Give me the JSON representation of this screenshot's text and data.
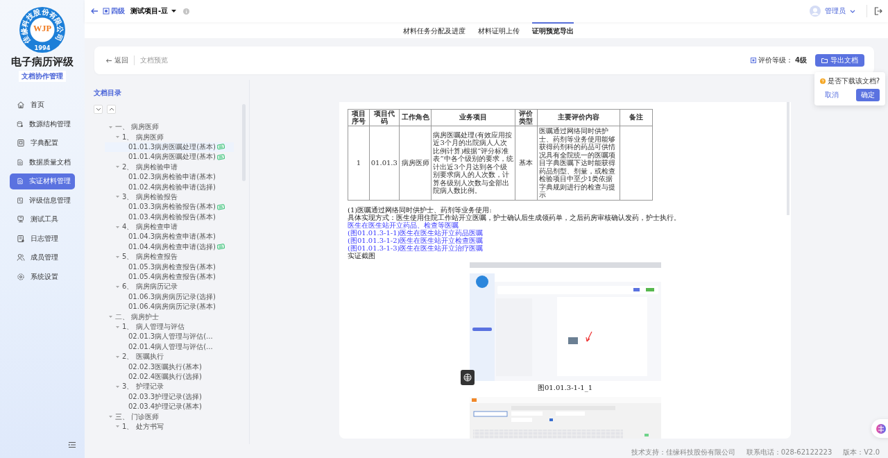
{
  "sidebar": {
    "logo": {
      "ring": "佳缘科技股份有限公司",
      "mark": "WJP",
      "year": "1994"
    },
    "title": "电子病历评级",
    "subtitle": "文档协作管理",
    "items": [
      {
        "label": "首页",
        "selected": false
      },
      {
        "label": "数源结构管理",
        "selected": false
      },
      {
        "label": "字典配置",
        "selected": false
      },
      {
        "label": "数据质量文档",
        "selected": false
      },
      {
        "label": "实证材料管理",
        "selected": true
      },
      {
        "label": "评级信息管理",
        "selected": false
      },
      {
        "label": "测试工具",
        "selected": false
      },
      {
        "label": "日志管理",
        "selected": false
      },
      {
        "label": "成员管理",
        "selected": false
      },
      {
        "label": "系统设置",
        "selected": false
      }
    ]
  },
  "header": {
    "level_badge": "四级",
    "project": "测试项目-豆",
    "user": "管理员"
  },
  "tabs": [
    {
      "label": "材料任务分配及进度",
      "selected": false
    },
    {
      "label": "材料证明上传",
      "selected": false
    },
    {
      "label": "证明预览导出",
      "selected": true
    }
  ],
  "toolbar": {
    "back": "返回",
    "crumb": "文档预览",
    "grade_label": "评价等级：",
    "grade": "4级",
    "export": "导出文档"
  },
  "popconfirm": {
    "message": "是否下载该文档?",
    "cancel": "取消",
    "confirm": "确定"
  },
  "catalog": {
    "title": "文档目录",
    "tree": [
      {
        "label": "一、 病房医师",
        "expanded": true,
        "children": [
          {
            "label": "1、 病房医师",
            "expanded": true,
            "children": [
              {
                "label": "01.01.3病房医嘱处理(基本)",
                "selected": true,
                "uploaded": true
              },
              {
                "label": "01.01.4病房医嘱处理(基本)",
                "selected": false,
                "uploaded": true
              }
            ]
          },
          {
            "label": "2、 病房检验申请",
            "expanded": true,
            "children": [
              {
                "label": "01.02.3病房检验申请(基本)",
                "selected": false,
                "uploaded": false
              },
              {
                "label": "01.02.4病房检验申请(选择)",
                "selected": false,
                "uploaded": false
              }
            ]
          },
          {
            "label": "3、 病房检验报告",
            "expanded": true,
            "children": [
              {
                "label": "01.03.3病房检验报告(基本)",
                "selected": false,
                "uploaded": true
              },
              {
                "label": "01.03.4病房检验报告(基本)",
                "selected": false,
                "uploaded": false
              }
            ]
          },
          {
            "label": "4、 病房检查申请",
            "expanded": true,
            "children": [
              {
                "label": "01.04.3病房检查申请(基本)",
                "selected": false,
                "uploaded": false
              },
              {
                "label": "01.04.4病房检查申请(选择)",
                "selected": false,
                "uploaded": true
              }
            ]
          },
          {
            "label": "5、 病房检查报告",
            "expanded": true,
            "children": [
              {
                "label": "01.05.3病房检查报告(基本)",
                "selected": false,
                "uploaded": false
              },
              {
                "label": "01.05.4病房检查报告(基本)",
                "selected": false,
                "uploaded": false
              }
            ]
          },
          {
            "label": "6、 病房病历记录",
            "expanded": true,
            "children": [
              {
                "label": "01.06.3病房病历记录(选择)",
                "selected": false,
                "uploaded": false
              },
              {
                "label": "01.06.4病房病历记录(基本)",
                "selected": false,
                "uploaded": false
              }
            ]
          }
        ]
      },
      {
        "label": "二、 病房护士",
        "expanded": true,
        "children": [
          {
            "label": "1、 病人管理与评估",
            "expanded": true,
            "children": [
              {
                "label": "02.01.3病人管理与评估(...",
                "selected": false,
                "uploaded": false
              },
              {
                "label": "02.01.4病人管理与评估(...",
                "selected": false,
                "uploaded": false
              }
            ]
          },
          {
            "label": "2、 医嘱执行",
            "expanded": true,
            "children": [
              {
                "label": "02.02.3医嘱执行(基本)",
                "selected": false,
                "uploaded": false
              },
              {
                "label": "02.02.4医嘱执行(选择)",
                "selected": false,
                "uploaded": false
              }
            ]
          },
          {
            "label": "3、 护理记录",
            "expanded": true,
            "children": [
              {
                "label": "02.03.3护理记录(选择)",
                "selected": false,
                "uploaded": false
              },
              {
                "label": "02.03.4护理记录(基本)",
                "selected": false,
                "uploaded": false
              }
            ]
          }
        ]
      },
      {
        "label": "三、 门诊医师",
        "expanded": true,
        "children": [
          {
            "label": "1、 处方书写",
            "expanded": true
          }
        ]
      }
    ]
  },
  "document": {
    "table": {
      "columns": [
        "项目序号",
        "项目代码",
        "工作角色",
        "业务项目",
        "评价类型",
        "主要评价内容",
        "备注"
      ],
      "rows": [
        [
          "1",
          "01.01.3",
          "病房医师",
          "病房医嘱处理(有效应用按近3个月的出院病人人次比例计算)根据“评分标准表”中各个级别的要求，统计出近3个月达到各个级别要求病人的人次数，计算各级别人次数与全部出院病人数比例。",
          "基本",
          "医嘱通过网络同时供护士、药剂等业务使用能够获得药剂科的药品可供情况具有全院统一的医嘱项目字典医嘱下达时能获得药品剂型、剂量，或检查检验项目中至少1类依据字典规则进行的检查与提示",
          ""
        ]
      ]
    },
    "paragraphs": [
      {
        "kind": "text",
        "text": "(1)医嘱通过网络同时供护士、药剂等业务使用:"
      },
      {
        "kind": "text",
        "text": "具体实现方式：医生使用住院工作站开立医嘱，护士确认后生成领药单，之后药房审核确认发药，护士执行。"
      },
      {
        "kind": "link",
        "text": "医生在医生站开立药品、检查等医嘱"
      },
      {
        "kind": "link",
        "text": "(图01.01.3-1-1)医生在医生站开立药品医嘱"
      },
      {
        "kind": "link",
        "text": "(图01.01.3-1-2)医生在医生站开立检查医嘱"
      },
      {
        "kind": "link",
        "text": "(图01.01.3-1-3)医生在医生站开立治疗医嘱"
      },
      {
        "kind": "text",
        "text": "实证截图"
      }
    ],
    "figures": [
      {
        "kind": "browser",
        "caption": "图01.01.3-1-1_1"
      },
      {
        "kind": "tool"
      }
    ]
  },
  "footer": [
    "技术支持：佳缘科技股份有限公司",
    "联系电话：028-62122223",
    "版本：V2.0"
  ]
}
